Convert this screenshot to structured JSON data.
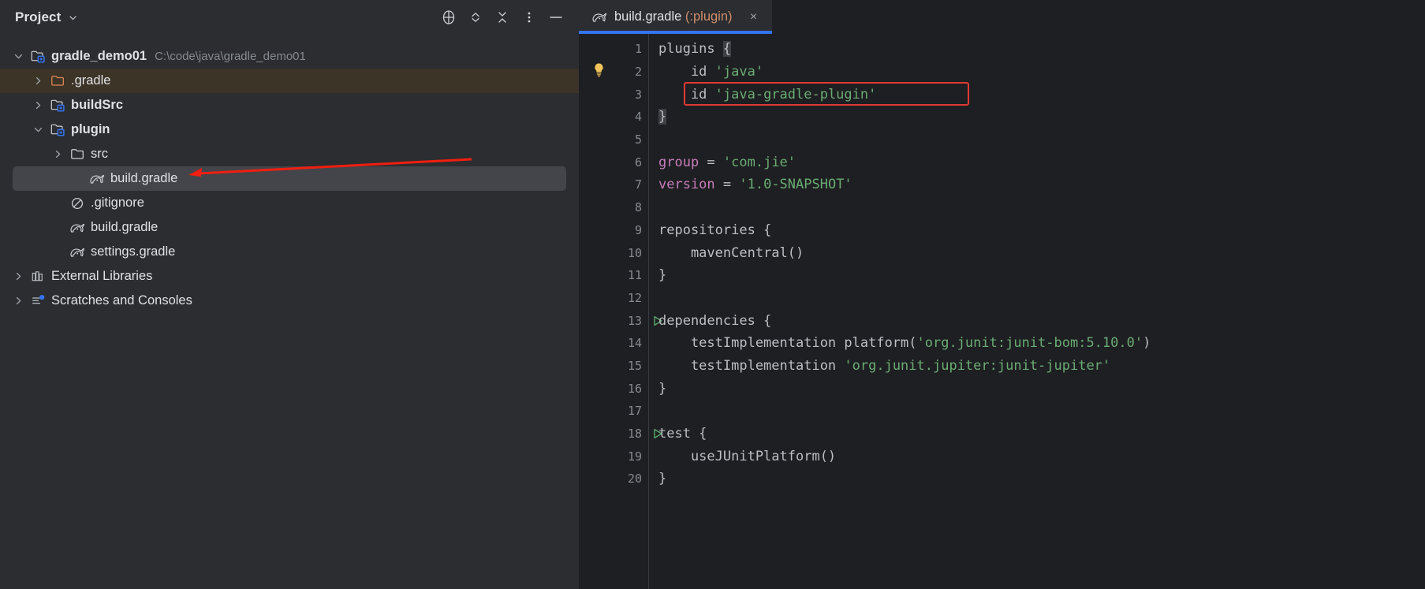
{
  "theme": {
    "panel_bg": "#2b2d30",
    "editor_bg": "#1e1f22",
    "accent": "#3574f0",
    "selection": "#43454a",
    "dir_highlight": "#3c3427",
    "string_color": "#6aab73",
    "property_color": "#c77dbb",
    "module_color": "#cf8e6d",
    "annotation_red": "#e03a33",
    "run_green": "#59a869",
    "text": "#dfe1e5",
    "muted_text": "#868a91"
  },
  "project_panel": {
    "title": "Project",
    "title_chevron": "chevron-down-icon",
    "header_buttons": [
      {
        "name": "select-opened-file-icon",
        "glyph": "crosshair"
      },
      {
        "name": "expand-collapse-icon",
        "glyph": "chevrons"
      },
      {
        "name": "collapse-all-icon",
        "glyph": "collapse"
      },
      {
        "name": "more-options-icon",
        "glyph": "kebab"
      },
      {
        "name": "hide-panel-icon",
        "glyph": "minus"
      }
    ],
    "tree": [
      {
        "label": "gradle_demo01",
        "path": "C:\\code\\java\\gradle_demo01",
        "icon": "module-folder-icon",
        "arrow": "down",
        "indent": 0,
        "bold": true,
        "state": "none"
      },
      {
        "label": ".gradle",
        "path": "",
        "icon": "excluded-folder-icon",
        "arrow": "right",
        "indent": 1,
        "bold": false,
        "state": "dir-highlight"
      },
      {
        "label": "buildSrc",
        "path": "",
        "icon": "module-folder-icon",
        "arrow": "right",
        "indent": 1,
        "bold": true,
        "state": "none"
      },
      {
        "label": "plugin",
        "path": "",
        "icon": "module-folder-icon",
        "arrow": "down",
        "indent": 1,
        "bold": true,
        "state": "none"
      },
      {
        "label": "src",
        "path": "",
        "icon": "folder-icon",
        "arrow": "right",
        "indent": 2,
        "bold": false,
        "state": "none"
      },
      {
        "label": "build.gradle",
        "path": "",
        "icon": "gradle-file-icon",
        "arrow": "none",
        "indent": 3,
        "bold": false,
        "state": "selected"
      },
      {
        "label": ".gitignore",
        "path": "",
        "icon": "gitignore-icon",
        "arrow": "none",
        "indent": 2,
        "bold": false,
        "state": "none"
      },
      {
        "label": "build.gradle",
        "path": "",
        "icon": "gradle-file-icon",
        "arrow": "none",
        "indent": 2,
        "bold": false,
        "state": "none"
      },
      {
        "label": "settings.gradle",
        "path": "",
        "icon": "gradle-file-icon",
        "arrow": "none",
        "indent": 2,
        "bold": false,
        "state": "none"
      },
      {
        "label": "External Libraries",
        "path": "",
        "icon": "libraries-icon",
        "arrow": "right",
        "indent": 0,
        "bold": false,
        "state": "none"
      },
      {
        "label": "Scratches and Consoles",
        "path": "",
        "icon": "scratches-icon",
        "arrow": "right",
        "indent": 0,
        "bold": false,
        "state": "none"
      }
    ],
    "annotation": {
      "name": "red-pointer-arrow",
      "description": "red arrow pointing to plugin/build.gradle"
    }
  },
  "editor": {
    "tab": {
      "icon": "gradle-file-icon",
      "title": "build.gradle",
      "module": "(:plugin)",
      "close": "×"
    },
    "highlight_box": {
      "line": 3,
      "color": "#e03a33"
    },
    "lines": [
      {
        "n": "1",
        "run": false,
        "bulb": false,
        "tokens": [
          {
            "t": "plugins ",
            "c": "kw"
          },
          {
            "t": "{",
            "c": "brace"
          }
        ]
      },
      {
        "n": "2",
        "run": false,
        "bulb": true,
        "tokens": [
          {
            "t": "    id ",
            "c": "kw"
          },
          {
            "t": "'java'",
            "c": "str"
          }
        ]
      },
      {
        "n": "3",
        "run": false,
        "bulb": false,
        "tokens": [
          {
            "t": "    id ",
            "c": "kw"
          },
          {
            "t": "'java-gradle-plugin'",
            "c": "str"
          }
        ]
      },
      {
        "n": "4",
        "run": false,
        "bulb": false,
        "tokens": [
          {
            "t": "}",
            "c": "brace"
          }
        ]
      },
      {
        "n": "5",
        "run": false,
        "bulb": false,
        "tokens": []
      },
      {
        "n": "6",
        "run": false,
        "bulb": false,
        "tokens": [
          {
            "t": "group",
            "c": "prop"
          },
          {
            "t": " = ",
            "c": "kw"
          },
          {
            "t": "'com.jie'",
            "c": "str"
          }
        ]
      },
      {
        "n": "7",
        "run": false,
        "bulb": false,
        "tokens": [
          {
            "t": "version",
            "c": "prop"
          },
          {
            "t": " = ",
            "c": "kw"
          },
          {
            "t": "'1.0-SNAPSHOT'",
            "c": "str"
          }
        ]
      },
      {
        "n": "8",
        "run": false,
        "bulb": false,
        "tokens": []
      },
      {
        "n": "9",
        "run": false,
        "bulb": false,
        "tokens": [
          {
            "t": "repositories {",
            "c": "kw"
          }
        ]
      },
      {
        "n": "10",
        "run": false,
        "bulb": false,
        "tokens": [
          {
            "t": "    mavenCentral()",
            "c": "kw"
          }
        ]
      },
      {
        "n": "11",
        "run": false,
        "bulb": false,
        "tokens": [
          {
            "t": "}",
            "c": "kw"
          }
        ]
      },
      {
        "n": "12",
        "run": false,
        "bulb": false,
        "tokens": []
      },
      {
        "n": "13",
        "run": true,
        "bulb": false,
        "tokens": [
          {
            "t": "dependencies {",
            "c": "kw"
          }
        ]
      },
      {
        "n": "14",
        "run": false,
        "bulb": false,
        "tokens": [
          {
            "t": "    testImplementation platform(",
            "c": "kw"
          },
          {
            "t": "'org.junit:junit-bom:5.10.0'",
            "c": "str"
          },
          {
            "t": ")",
            "c": "kw"
          }
        ]
      },
      {
        "n": "15",
        "run": false,
        "bulb": false,
        "tokens": [
          {
            "t": "    testImplementation ",
            "c": "kw"
          },
          {
            "t": "'org.junit.jupiter:junit-jupiter'",
            "c": "str"
          }
        ]
      },
      {
        "n": "16",
        "run": false,
        "bulb": false,
        "tokens": [
          {
            "t": "}",
            "c": "kw"
          }
        ]
      },
      {
        "n": "17",
        "run": false,
        "bulb": false,
        "tokens": []
      },
      {
        "n": "18",
        "run": true,
        "bulb": false,
        "tokens": [
          {
            "t": "test {",
            "c": "kw"
          }
        ]
      },
      {
        "n": "19",
        "run": false,
        "bulb": false,
        "tokens": [
          {
            "t": "    useJUnitPlatform()",
            "c": "kw"
          }
        ]
      },
      {
        "n": "20",
        "run": false,
        "bulb": false,
        "tokens": [
          {
            "t": "}",
            "c": "kw"
          }
        ]
      }
    ]
  }
}
